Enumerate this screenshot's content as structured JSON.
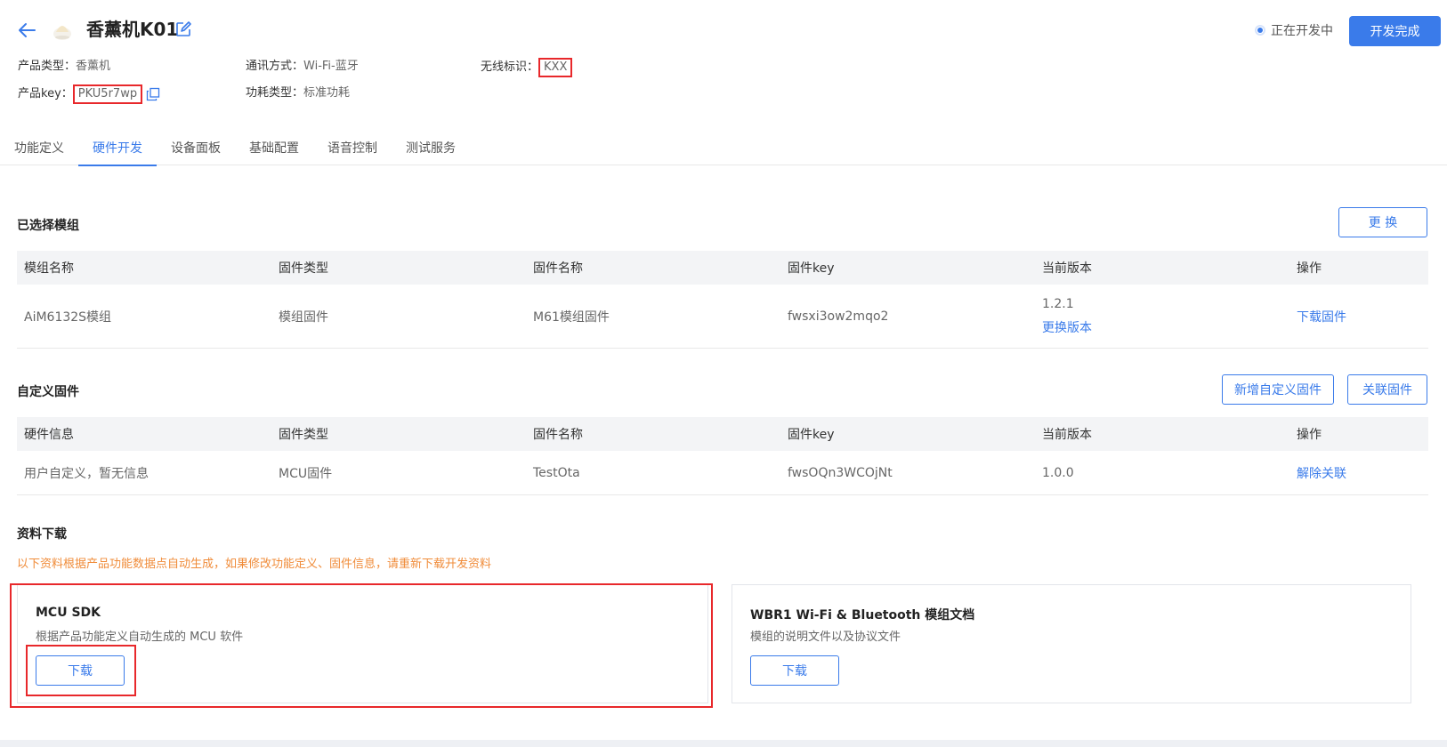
{
  "header": {
    "title": "香薰机K01",
    "status": "正在开发中",
    "complete_button": "开发完成",
    "meta": {
      "product_type_label": "产品类型",
      "product_type_value": "香薰机",
      "comm_label": "通讯方式",
      "comm_value": "Wi-Fi-蓝牙",
      "wireless_label": "无线标识",
      "wireless_value": "KXX",
      "key_label": "产品key",
      "key_value": "PKU5r7wp",
      "power_label": "功耗类型",
      "power_value": "标准功耗"
    }
  },
  "tabs": [
    {
      "label": "功能定义"
    },
    {
      "label": "硬件开发"
    },
    {
      "label": "设备面板"
    },
    {
      "label": "基础配置"
    },
    {
      "label": "语音控制"
    },
    {
      "label": "测试服务"
    }
  ],
  "selected_module": {
    "title": "已选择模组",
    "change_button": "更 换",
    "columns": [
      "模组名称",
      "固件类型",
      "固件名称",
      "固件key",
      "当前版本",
      "操作"
    ],
    "row": {
      "name": "AiM6132S模组",
      "firmware_type": "模组固件",
      "firmware_name": "M61模组固件",
      "firmware_key": "fwsxi3ow2mqo2",
      "version": "1.2.1",
      "change_version": "更换版本",
      "action": "下载固件"
    }
  },
  "custom_firmware": {
    "title": "自定义固件",
    "add_button": "新增自定义固件",
    "link_button": "关联固件",
    "columns": [
      "硬件信息",
      "固件类型",
      "固件名称",
      "固件key",
      "当前版本",
      "操作"
    ],
    "row": {
      "info": "用户自定义，暂无信息",
      "firmware_type": "MCU固件",
      "firmware_name": "TestOta",
      "firmware_key": "fwsOQn3WCOjNt",
      "version": "1.0.0",
      "action": "解除关联"
    }
  },
  "downloads": {
    "title": "资料下载",
    "notice": "以下资料根据产品功能数据点自动生成，如果修改功能定义、固件信息，请重新下载开发资料",
    "cards": [
      {
        "title": "MCU SDK",
        "desc": "根据产品功能定义自动生成的 MCU 软件",
        "button": "下载"
      },
      {
        "title": "WBR1 Wi-Fi & Bluetooth 模组文档",
        "desc": "模组的说明文件以及协议文件",
        "button": "下载"
      }
    ]
  },
  "colors": {
    "accent": "#3a7bea",
    "warning": "#f08c3a",
    "highlight": "#e8282b"
  }
}
